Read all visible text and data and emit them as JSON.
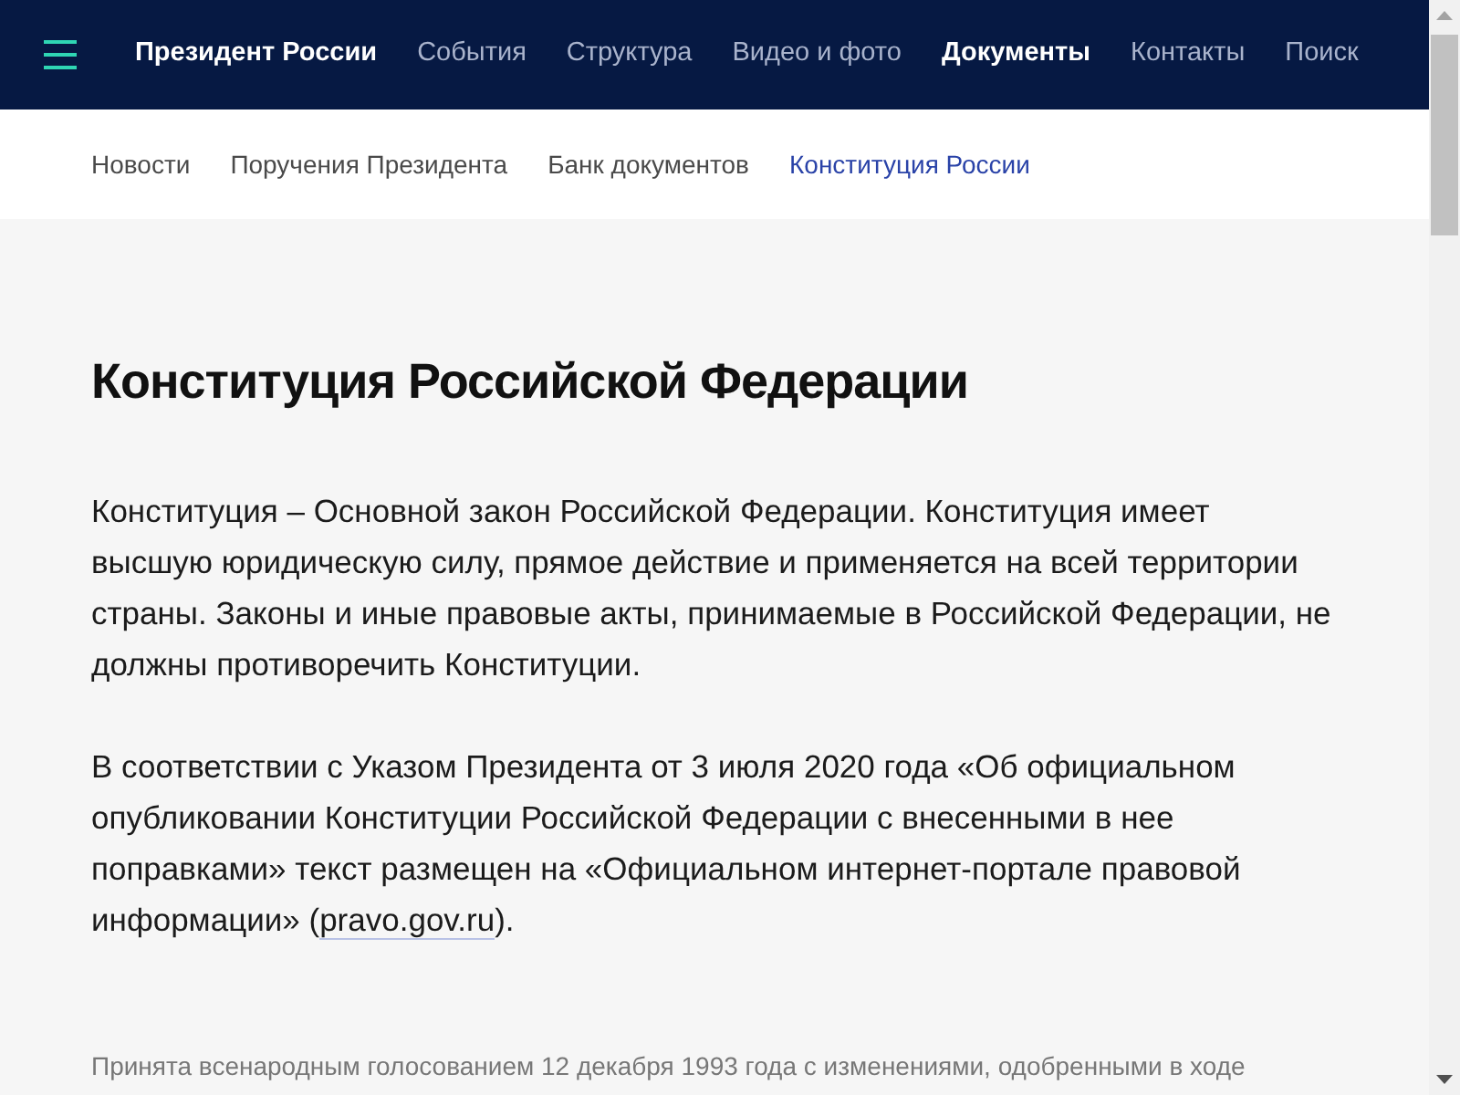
{
  "header": {
    "brand": "Президент России",
    "nav": [
      {
        "label": "События",
        "selected": false
      },
      {
        "label": "Структура",
        "selected": false
      },
      {
        "label": "Видео и фото",
        "selected": false
      },
      {
        "label": "Документы",
        "selected": true
      },
      {
        "label": "Контакты",
        "selected": false
      },
      {
        "label": "Поиск",
        "selected": false
      }
    ]
  },
  "subnav": [
    {
      "label": "Новости",
      "selected": false
    },
    {
      "label": "Поручения Президента",
      "selected": false
    },
    {
      "label": "Банк документов",
      "selected": false
    },
    {
      "label": "Конституция России",
      "selected": true
    }
  ],
  "title": "Конституция Российской Федерации",
  "paragraphs": [
    {
      "text": "Конституция – Основной закон Российской Федерации. Конституция имеет высшую юридическую силу, прямое действие и применяется на всей территории страны. Законы и иные правовые акты, принимаемые в Российской Федерации, не должны противоречить Конституции."
    },
    {
      "text": "В соответствии с Указом Президента от 3 июля 2020 года «Об официальном опубликовании Конституции Российской Федерации с внесенными в нее поправками» текст размещен на «Официальном интернет-портале правовой информации» (",
      "link": "pravo.gov.ru",
      "after": ")."
    }
  ],
  "note": "Принята всенародным голосованием 12 декабря 1993 года с изменениями, одобренными в ходе"
}
